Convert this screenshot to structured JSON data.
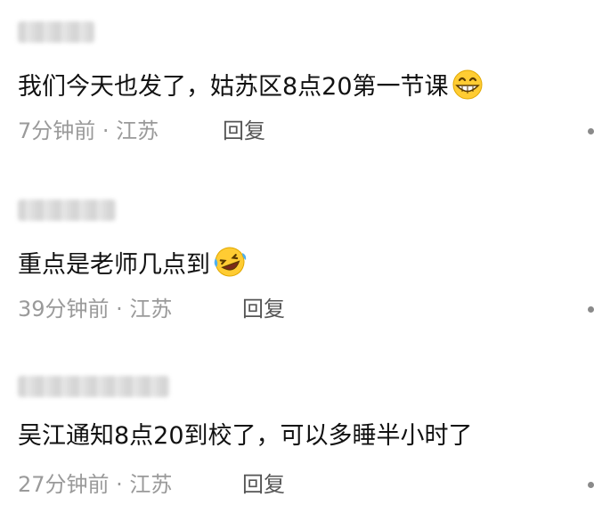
{
  "comments": [
    {
      "text": "我们今天也发了，姑苏区8点20第一节课",
      "emoji": "grinning-face-emoji",
      "meta": "7分钟前 · 江苏",
      "reply": "回复"
    },
    {
      "text": "重点是老师几点到",
      "emoji": "laughing-crying-face-emoji",
      "meta": "39分钟前 · 江苏",
      "reply": "回复"
    },
    {
      "text": "吴江通知8点20到校了，可以多睡半小时了",
      "emoji": "",
      "meta": "27分钟前 · 江苏",
      "reply": "回复"
    }
  ]
}
